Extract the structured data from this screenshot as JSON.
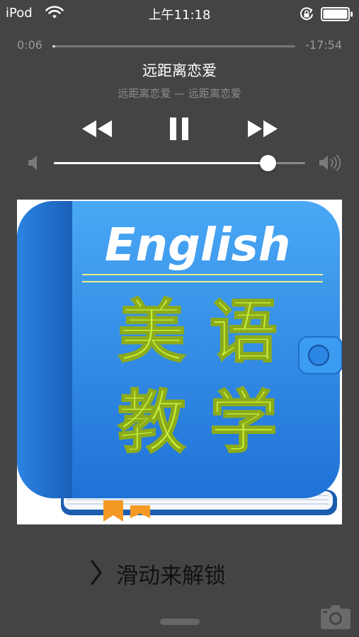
{
  "status_bar": {
    "carrier": "iPod",
    "time": "上午11:18",
    "battery_level": 1.0
  },
  "playback": {
    "elapsed": "0:06",
    "remaining": "-17:54",
    "progress": 0.006
  },
  "track": {
    "title": "远距离恋爱",
    "subtitle": "远距离恋爱 — 远距离恋爱"
  },
  "controls": {
    "rewind_icon": "rewind-icon",
    "pause_icon": "pause-icon",
    "forward_icon": "fast-forward-icon"
  },
  "volume": {
    "level": 0.85,
    "low_icon": "speaker-low-icon",
    "high_icon": "speaker-high-icon"
  },
  "artwork": {
    "heading": "English",
    "line1": "美 语",
    "line2": "教 学"
  },
  "lock_screen": {
    "unlock_text": "滑动来解锁"
  },
  "colors": {
    "background": "#444444",
    "accent_text": "#c8f03a",
    "art_blue": "#2f8fe6"
  }
}
